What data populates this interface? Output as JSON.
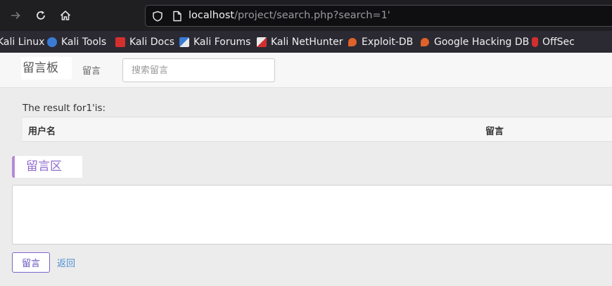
{
  "browser": {
    "url_host": "localhost",
    "url_path": "/project/search.php?search=1'"
  },
  "bookmarks": [
    {
      "label": "Kali Linux",
      "icon": "kali-linux-icon"
    },
    {
      "label": "Kali Tools",
      "icon": "kali-tools-icon"
    },
    {
      "label": "Kali Docs",
      "icon": "kali-docs-icon"
    },
    {
      "label": "Kali Forums",
      "icon": "kali-forums-icon"
    },
    {
      "label": "Kali NetHunter",
      "icon": "kali-nethunter-icon"
    },
    {
      "label": "Exploit-DB",
      "icon": "exploit-db-icon"
    },
    {
      "label": "Google Hacking DB",
      "icon": "google-hacking-db-icon"
    },
    {
      "label": "OffSec",
      "icon": "offsec-icon"
    }
  ],
  "navbar": {
    "brand": "留言板",
    "link": "留言",
    "search_placeholder": "搜索留言"
  },
  "results": {
    "text": "The result for1'is:",
    "columns": [
      "用户名",
      "留言"
    ]
  },
  "comment": {
    "section_title": "留言区",
    "submit_label": "留言",
    "back_label": "返回"
  },
  "colors": {
    "accent_purple": "#8f6ad0",
    "link_blue": "#4a8ed0",
    "toolbar_bg": "#1f1f22",
    "bookmarks_bg": "#2b2a33"
  }
}
